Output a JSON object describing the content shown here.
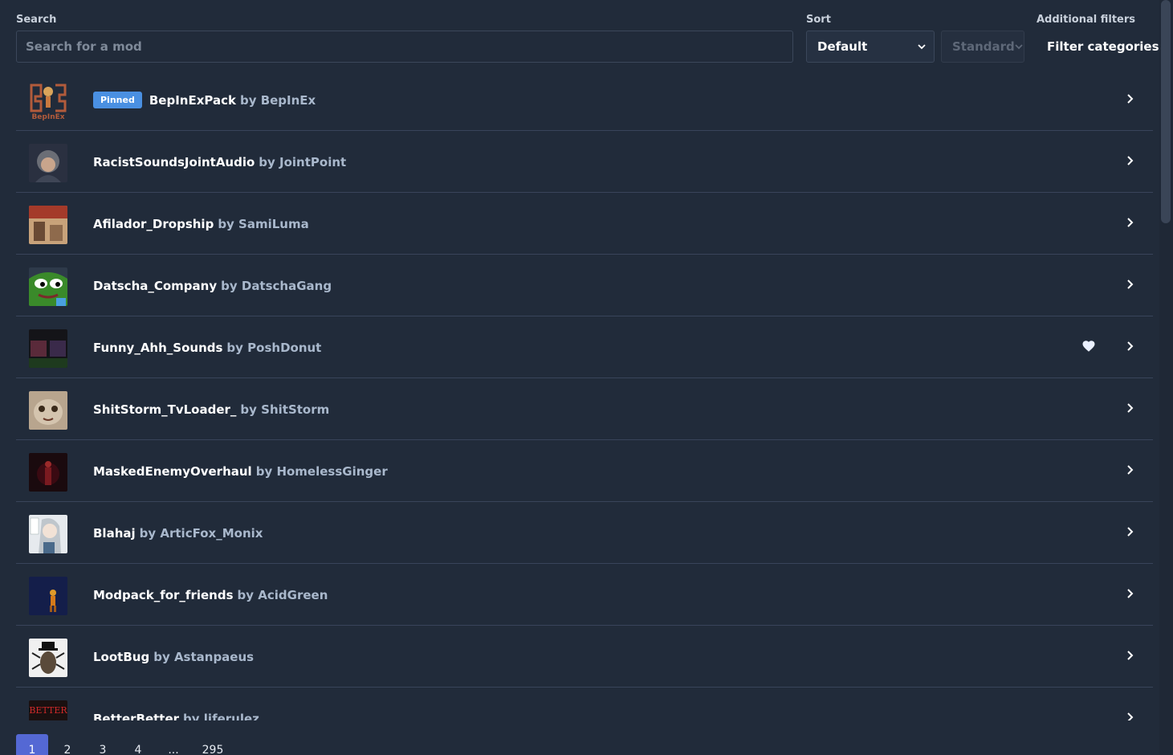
{
  "filters": {
    "search_label": "Search",
    "search_placeholder": "Search for a mod",
    "sort_label": "Sort",
    "sort_value": "Default",
    "order_value": "Standard",
    "additional_label": "Additional filters",
    "filter_categories": "Filter categories"
  },
  "mods": [
    {
      "pinned": true,
      "badge": "Pinned",
      "name": "BepInExPack",
      "by": "by BepInEx",
      "favorite": false,
      "thumb": "bepinex"
    },
    {
      "pinned": false,
      "name": "RacistSoundsJointAudio",
      "by": "by JointPoint",
      "favorite": false,
      "thumb": "portrait"
    },
    {
      "pinned": false,
      "name": "Afilador_Dropship",
      "by": "by SamiLuma",
      "favorite": false,
      "thumb": "poster"
    },
    {
      "pinned": false,
      "name": "Datscha_Company",
      "by": "by DatschaGang",
      "favorite": false,
      "thumb": "frog"
    },
    {
      "pinned": false,
      "name": "Funny_Ahh_Sounds",
      "by": "by PoshDonut",
      "favorite": true,
      "thumb": "dark"
    },
    {
      "pinned": false,
      "name": "ShitStorm_TvLoader_",
      "by": "by ShitStorm",
      "favorite": false,
      "thumb": "cat"
    },
    {
      "pinned": false,
      "name": "MaskedEnemyOverhaul",
      "by": "by HomelessGinger",
      "favorite": false,
      "thumb": "red"
    },
    {
      "pinned": false,
      "name": "Blahaj",
      "by": "by ArticFox_Monix",
      "favorite": false,
      "thumb": "anime"
    },
    {
      "pinned": false,
      "name": "Modpack_for_friends",
      "by": "by AcidGreen",
      "favorite": false,
      "thumb": "blue"
    },
    {
      "pinned": false,
      "name": "LootBug",
      "by": "by Astanpaeus",
      "favorite": false,
      "thumb": "bug"
    },
    {
      "pinned": false,
      "name": "BetterBetter",
      "by": "by liferulez",
      "favorite": false,
      "thumb": "better"
    }
  ],
  "pagination": {
    "pages": [
      "1",
      "2",
      "3",
      "4",
      "...",
      "295"
    ],
    "active": "1"
  },
  "colors": {
    "background": "#212b3a",
    "pinned_badge": "#4a90e2",
    "active_page": "#5468d4",
    "author_text": "#a9b8cc"
  }
}
